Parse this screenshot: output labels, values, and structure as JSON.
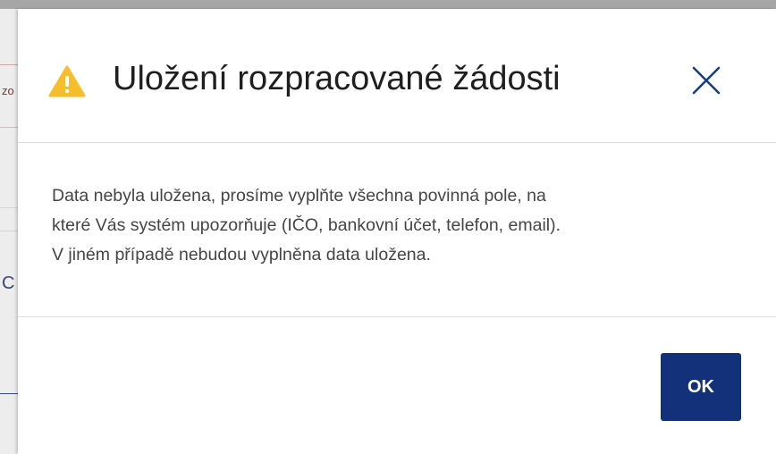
{
  "dialog": {
    "title": "Uložení rozpracované žádosti",
    "warning_icon": "warning-triangle-icon",
    "close_icon": "close-icon",
    "message_lines": [
      "Data nebyla uložena, prosíme vyplňte všechna povinná pole, na",
      "které Vás systém upozorňuje (IČO, bankovní účet, telefon, email).",
      "V jiném případě nebudou vyplněna data uložena."
    ],
    "ok_label": "OK"
  },
  "background": {
    "partial_chars": [
      "zo",
      "C"
    ]
  },
  "colors": {
    "warning": "#f7be2b",
    "close_icon": "#17407f",
    "primary_button": "#12317a",
    "title_text": "#1f1f1f",
    "body_text": "#454545"
  }
}
